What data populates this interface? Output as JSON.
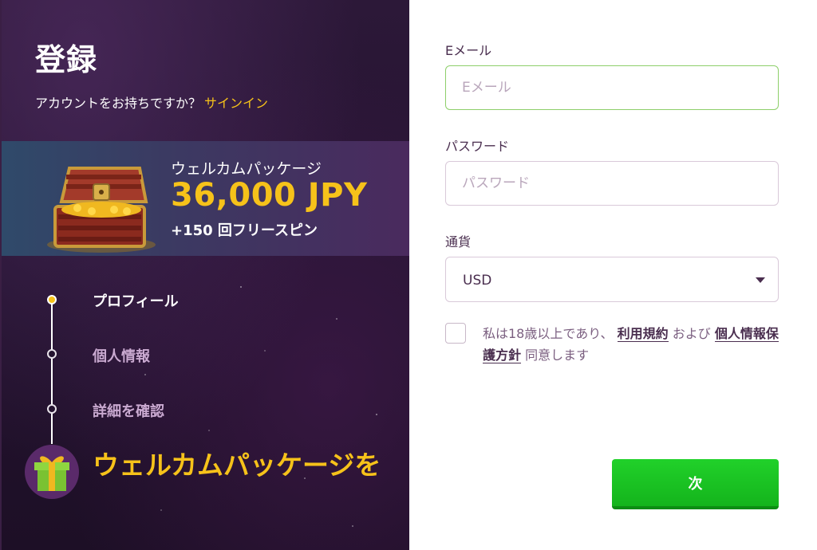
{
  "left": {
    "title": "登録",
    "signin_prompt": "アカウントをお持ちですか？",
    "signin_link": "サインイン",
    "promo": {
      "subtitle": "ウェルカムパッケージ",
      "amount": "36,000 JPY",
      "spins": "+150 回フリースピン"
    },
    "steps": [
      {
        "label": "プロフィール",
        "active": true
      },
      {
        "label": "個人情報",
        "active": false
      },
      {
        "label": "詳細を確認",
        "active": false
      }
    ],
    "welcome_text": "ウェルカムパッケージを"
  },
  "form": {
    "email": {
      "label": "Eメール",
      "placeholder": "Eメール",
      "value": ""
    },
    "password": {
      "label": "パスワード",
      "placeholder": "パスワード",
      "value": ""
    },
    "currency": {
      "label": "通貨",
      "value": "USD"
    },
    "terms": {
      "text_before": "私は18歳以上であり、",
      "terms_link": "利用規約",
      "text_middle": "および",
      "privacy_link": "個人情報保護方針",
      "text_after": "同意します",
      "checked": false
    },
    "next_label": "次"
  },
  "colors": {
    "accent_yellow": "#f6c21a",
    "button_green": "#14b41c",
    "panel_dark": "#241330"
  },
  "icons": {
    "chest": "treasure-chest-icon",
    "gift": "gift-icon",
    "caret": "chevron-down-icon"
  }
}
